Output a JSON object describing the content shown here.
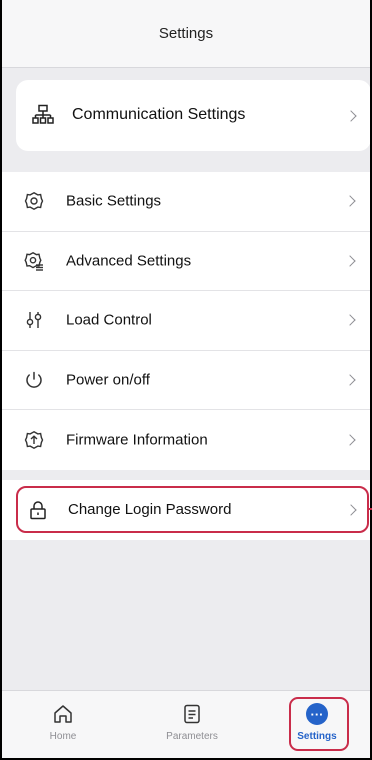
{
  "header": {
    "title": "Settings"
  },
  "communication": {
    "label": "Communication Settings",
    "icon": "network-icon"
  },
  "settings_list": [
    {
      "label": "Basic Settings",
      "icon": "gear-icon"
    },
    {
      "label": "Advanced Settings",
      "icon": "advanced-gear-icon"
    },
    {
      "label": "Load Control",
      "icon": "sliders-icon"
    },
    {
      "label": "Power on/off",
      "icon": "power-icon"
    },
    {
      "label": "Firmware Information",
      "icon": "firmware-icon"
    }
  ],
  "password": {
    "label": "Change Login Password",
    "icon": "lock-icon"
  },
  "tabs": [
    {
      "label": "Home",
      "icon": "home-icon"
    },
    {
      "label": "Parameters",
      "icon": "document-icon"
    },
    {
      "label": "Settings",
      "icon": "more-dots-icon",
      "active": true
    }
  ],
  "colors": {
    "accent": "#2563c9",
    "highlight": "#c92c4a",
    "background": "#ececef"
  }
}
